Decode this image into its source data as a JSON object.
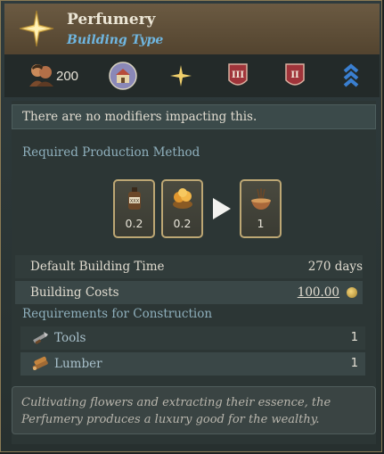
{
  "header": {
    "title": "Perfumery",
    "subtitle": "Building Type",
    "emblem_icon": "gold-star-emblem-icon"
  },
  "icon_row": {
    "population_icon": "population-icon",
    "population_count": "200",
    "items": [
      {
        "name": "estate-icon",
        "desc": "round building portrait"
      },
      {
        "name": "star-icon",
        "desc": "gold four-point star"
      },
      {
        "name": "tier-3-badge-icon",
        "text": "III"
      },
      {
        "name": "tier-2-badge-icon",
        "text": "II"
      },
      {
        "name": "rank-chevrons-icon"
      }
    ]
  },
  "modifiers_banner": "There are no modifiers impacting this.",
  "production": {
    "section_label": "Required Production Method",
    "inputs": [
      {
        "icon": "perfume-bottle-icon",
        "value": "0.2"
      },
      {
        "icon": "flowers-icon",
        "value": "0.2"
      }
    ],
    "outputs": [
      {
        "icon": "incense-bowl-icon",
        "value": "1"
      }
    ]
  },
  "stats": {
    "build_time_label": "Default Building Time",
    "build_time_value": "270 days",
    "costs_label": "Building Costs",
    "costs_value": "100.00"
  },
  "requirements": {
    "section_label": "Requirements for Construction",
    "items": [
      {
        "icon": "tools-icon",
        "label": "Tools",
        "value": "1"
      },
      {
        "icon": "lumber-icon",
        "label": "Lumber",
        "value": "1"
      }
    ]
  },
  "description": "Cultivating flowers and extracting their essence, the Perfumery produces a luxury good for the wealthy.",
  "colors": {
    "accent_gold": "#bda774",
    "subtitle_blue": "#6fb6e0",
    "badge_red": "#a0343a",
    "chevron_blue": "#3a7fd0"
  }
}
